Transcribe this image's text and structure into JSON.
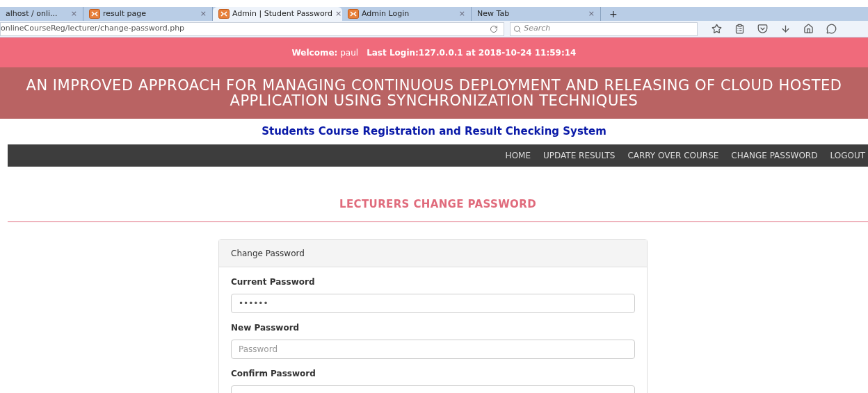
{
  "browser": {
    "tabs": [
      {
        "title": "alhost / onli...",
        "icon": false,
        "selected": false
      },
      {
        "title": "result page",
        "icon": true,
        "selected": false
      },
      {
        "title": "Admin | Student Password",
        "icon": true,
        "selected": true
      },
      {
        "title": "Admin Login",
        "icon": true,
        "selected": false
      },
      {
        "title": "New Tab",
        "icon": false,
        "selected": false
      }
    ],
    "new_tab": "+",
    "close": "×",
    "url": "onlineCourseReg/lecturer/change-password.php",
    "search_placeholder": "Search"
  },
  "welcome": {
    "label": "Welcome:",
    "user": "paul",
    "last_login": "Last Login:127.0.0.1 at 2018-10-24 11:59:14"
  },
  "banner": {
    "title": "AN IMPROVED APPROACH FOR MANAGING CONTINUOUS DEPLOYMENT AND RELEASING OF CLOUD HOSTED APPLICATION USING SYNCHRONIZATION TECHNIQUES"
  },
  "subtitle": "Students Course Registration and Result Checking System",
  "nav": [
    "HOME",
    "UPDATE RESULTS",
    "CARRY OVER COURSE",
    "CHANGE PASSWORD",
    "LOGOUT"
  ],
  "page_heading": "LECTURERS CHANGE PASSWORD",
  "panel": {
    "title": "Change Password",
    "fields": [
      {
        "label": "Current Password",
        "value": "••••••"
      },
      {
        "label": "New Password",
        "placeholder": "Password"
      },
      {
        "label": "Confirm Password"
      }
    ]
  }
}
